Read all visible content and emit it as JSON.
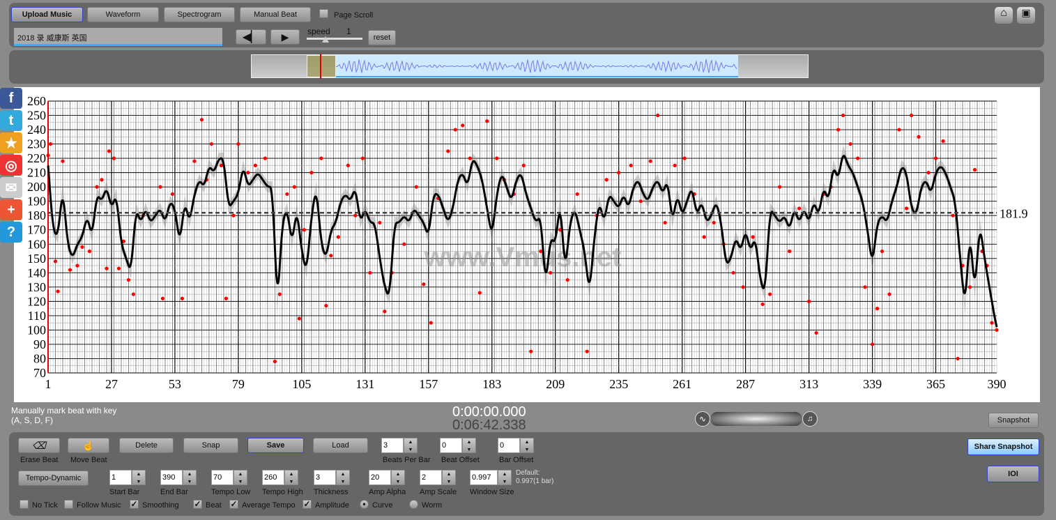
{
  "toolbar": {
    "upload": "Upload Music",
    "waveform": "Waveform",
    "spectrogram": "Spectrogram",
    "manual_beat": "Manual Beat",
    "page_scroll": "Page Scroll",
    "song_title": "2018 录 威康斯 英国",
    "speed_label": "speed",
    "speed_value": "1",
    "reset": "reset"
  },
  "social": [
    "facebook-icon",
    "twitter-icon",
    "favorite-icon",
    "weibo-icon",
    "email-icon",
    "add-icon",
    "help-icon"
  ],
  "status": {
    "hint_line1": "Manually mark beat with key",
    "hint_line2": "(A, S, D, F)",
    "time_current": "0:00:00.000",
    "time_total": "0:06:42.338",
    "snapshot": "Snapshot",
    "share_snapshot": "Share Snapshot",
    "ioi": "IOI"
  },
  "controls": {
    "erase_beat": "Erase Beat",
    "move_beat": "Move Beat",
    "delete": "Delete",
    "snap": "Snap",
    "save": "Save",
    "load": "Load",
    "tempo_dynamic": "Tempo-Dynamic",
    "beats_per_bar": {
      "label": "Beats Per Bar",
      "value": "3"
    },
    "beat_offset": {
      "label": "Beat Offset",
      "value": "0"
    },
    "bar_offset": {
      "label": "Bar Offset",
      "value": "0"
    },
    "start_bar": {
      "label": "Start Bar",
      "value": "1"
    },
    "end_bar": {
      "label": "End Bar",
      "value": "390"
    },
    "tempo_low": {
      "label": "Tempo Low",
      "value": "70"
    },
    "tempo_high": {
      "label": "Tempo High",
      "value": "260"
    },
    "thickness": {
      "label": "Thickness",
      "value": "3"
    },
    "amp_alpha": {
      "label": "Amp Alpha",
      "value": "20"
    },
    "amp_scale": {
      "label": "Amp Scale",
      "value": "2"
    },
    "window_size": {
      "label": "Window Size",
      "value": "0.997"
    },
    "default_line1": "Default:",
    "default_line2": "0.997(1 bar)",
    "no_tick": {
      "label": "No Tick",
      "checked": false
    },
    "follow_music": {
      "label": "Follow Music",
      "checked": false
    },
    "smoothing": {
      "label": "Smoothing",
      "checked": true
    },
    "beat": {
      "label": "Beat",
      "checked": true
    },
    "average_tempo": {
      "label": "Average Tempo",
      "checked": true
    },
    "amplitude": {
      "label": "Amplitude",
      "checked": true
    },
    "curve": {
      "label": "Curve",
      "selected": true
    },
    "worm": {
      "label": "Worm",
      "selected": false
    }
  },
  "chart_data": {
    "type": "line",
    "watermark": "www.Vmus.net",
    "xlim": [
      1,
      390
    ],
    "ylim": [
      70,
      260
    ],
    "x_ticks": [
      1,
      27,
      53,
      79,
      105,
      131,
      157,
      183,
      209,
      235,
      261,
      287,
      313,
      339,
      365,
      390
    ],
    "y_ticks": [
      70,
      80,
      90,
      100,
      110,
      120,
      130,
      140,
      150,
      160,
      170,
      180,
      190,
      200,
      210,
      220,
      230,
      240,
      250,
      260
    ],
    "average_tempo": 181.9,
    "average_label": "181.9",
    "colors": {
      "curve": "#000000",
      "beats": "#ff0000",
      "average": "#444444"
    },
    "curve": [
      [
        1,
        215
      ],
      [
        3,
        170
      ],
      [
        5,
        165
      ],
      [
        7,
        200
      ],
      [
        9,
        160
      ],
      [
        11,
        150
      ],
      [
        13,
        160
      ],
      [
        15,
        165
      ],
      [
        17,
        180
      ],
      [
        19,
        165
      ],
      [
        21,
        195
      ],
      [
        23,
        190
      ],
      [
        25,
        200
      ],
      [
        27,
        185
      ],
      [
        29,
        195
      ],
      [
        31,
        160
      ],
      [
        33,
        150
      ],
      [
        35,
        140
      ],
      [
        37,
        185
      ],
      [
        39,
        175
      ],
      [
        41,
        185
      ],
      [
        43,
        175
      ],
      [
        45,
        180
      ],
      [
        47,
        185
      ],
      [
        49,
        175
      ],
      [
        51,
        190
      ],
      [
        53,
        185
      ],
      [
        55,
        160
      ],
      [
        57,
        190
      ],
      [
        59,
        175
      ],
      [
        61,
        195
      ],
      [
        63,
        205
      ],
      [
        65,
        200
      ],
      [
        67,
        215
      ],
      [
        69,
        210
      ],
      [
        71,
        220
      ],
      [
        73,
        220
      ],
      [
        75,
        185
      ],
      [
        77,
        190
      ],
      [
        79,
        195
      ],
      [
        81,
        215
      ],
      [
        83,
        200
      ],
      [
        85,
        205
      ],
      [
        87,
        210
      ],
      [
        89,
        205
      ],
      [
        91,
        200
      ],
      [
        93,
        200
      ],
      [
        95,
        115
      ],
      [
        97,
        175
      ],
      [
        99,
        185
      ],
      [
        101,
        160
      ],
      [
        103,
        185
      ],
      [
        105,
        155
      ],
      [
        107,
        140
      ],
      [
        109,
        180
      ],
      [
        111,
        200
      ],
      [
        113,
        160
      ],
      [
        115,
        150
      ],
      [
        117,
        170
      ],
      [
        119,
        175
      ],
      [
        121,
        190
      ],
      [
        123,
        195
      ],
      [
        125,
        190
      ],
      [
        127,
        200
      ],
      [
        129,
        175
      ],
      [
        131,
        185
      ],
      [
        133,
        175
      ],
      [
        135,
        175
      ],
      [
        137,
        150
      ],
      [
        139,
        130
      ],
      [
        141,
        122
      ],
      [
        143,
        175
      ],
      [
        145,
        175
      ],
      [
        147,
        180
      ],
      [
        149,
        175
      ],
      [
        151,
        185
      ],
      [
        153,
        180
      ],
      [
        155,
        175
      ],
      [
        157,
        165
      ],
      [
        159,
        195
      ],
      [
        161,
        195
      ],
      [
        163,
        185
      ],
      [
        165,
        175
      ],
      [
        167,
        185
      ],
      [
        169,
        205
      ],
      [
        171,
        210
      ],
      [
        173,
        200
      ],
      [
        175,
        220
      ],
      [
        177,
        215
      ],
      [
        179,
        205
      ],
      [
        181,
        185
      ],
      [
        183,
        165
      ],
      [
        185,
        195
      ],
      [
        187,
        210
      ],
      [
        189,
        200
      ],
      [
        191,
        190
      ],
      [
        193,
        205
      ],
      [
        195,
        210
      ],
      [
        197,
        195
      ],
      [
        199,
        185
      ],
      [
        201,
        175
      ],
      [
        203,
        180
      ],
      [
        205,
        130
      ],
      [
        207,
        165
      ],
      [
        209,
        160
      ],
      [
        211,
        190
      ],
      [
        213,
        140
      ],
      [
        215,
        175
      ],
      [
        217,
        185
      ],
      [
        219,
        170
      ],
      [
        221,
        155
      ],
      [
        223,
        125
      ],
      [
        225,
        165
      ],
      [
        227,
        190
      ],
      [
        229,
        175
      ],
      [
        231,
        195
      ],
      [
        233,
        190
      ],
      [
        235,
        185
      ],
      [
        237,
        195
      ],
      [
        239,
        185
      ],
      [
        241,
        200
      ],
      [
        243,
        205
      ],
      [
        245,
        195
      ],
      [
        247,
        190
      ],
      [
        249,
        200
      ],
      [
        251,
        205
      ],
      [
        253,
        195
      ],
      [
        255,
        205
      ],
      [
        257,
        175
      ],
      [
        259,
        195
      ],
      [
        261,
        180
      ],
      [
        263,
        190
      ],
      [
        265,
        200
      ],
      [
        267,
        180
      ],
      [
        269,
        190
      ],
      [
        271,
        175
      ],
      [
        273,
        180
      ],
      [
        275,
        190
      ],
      [
        277,
        175
      ],
      [
        279,
        145
      ],
      [
        281,
        150
      ],
      [
        283,
        165
      ],
      [
        285,
        155
      ],
      [
        287,
        170
      ],
      [
        289,
        155
      ],
      [
        291,
        165
      ],
      [
        293,
        135
      ],
      [
        295,
        125
      ],
      [
        297,
        185
      ],
      [
        299,
        180
      ],
      [
        301,
        175
      ],
      [
        303,
        180
      ],
      [
        305,
        170
      ],
      [
        307,
        185
      ],
      [
        309,
        175
      ],
      [
        311,
        185
      ],
      [
        313,
        175
      ],
      [
        315,
        190
      ],
      [
        317,
        180
      ],
      [
        319,
        200
      ],
      [
        321,
        190
      ],
      [
        323,
        215
      ],
      [
        325,
        205
      ],
      [
        327,
        225
      ],
      [
        329,
        215
      ],
      [
        331,
        210
      ],
      [
        333,
        200
      ],
      [
        335,
        190
      ],
      [
        337,
        170
      ],
      [
        339,
        145
      ],
      [
        341,
        175
      ],
      [
        343,
        180
      ],
      [
        345,
        175
      ],
      [
        347,
        190
      ],
      [
        349,
        200
      ],
      [
        351,
        215
      ],
      [
        353,
        210
      ],
      [
        355,
        185
      ],
      [
        357,
        180
      ],
      [
        359,
        200
      ],
      [
        361,
        205
      ],
      [
        363,
        195
      ],
      [
        365,
        210
      ],
      [
        367,
        215
      ],
      [
        369,
        210
      ],
      [
        371,
        200
      ],
      [
        373,
        190
      ],
      [
        375,
        150
      ],
      [
        377,
        115
      ],
      [
        379,
        170
      ],
      [
        381,
        125
      ],
      [
        383,
        175
      ],
      [
        385,
        150
      ],
      [
        387,
        130
      ],
      [
        389,
        110
      ],
      [
        390,
        102
      ]
    ],
    "beats": [
      [
        1,
        222
      ],
      [
        2,
        230
      ],
      [
        4,
        148
      ],
      [
        5,
        127
      ],
      [
        7,
        218
      ],
      [
        10,
        142
      ],
      [
        13,
        145
      ],
      [
        15,
        158
      ],
      [
        18,
        155
      ],
      [
        21,
        200
      ],
      [
        23,
        205
      ],
      [
        25,
        143
      ],
      [
        26,
        225
      ],
      [
        28,
        220
      ],
      [
        30,
        143
      ],
      [
        32,
        162
      ],
      [
        34,
        135
      ],
      [
        36,
        125
      ],
      [
        40,
        180
      ],
      [
        47,
        200
      ],
      [
        48,
        122
      ],
      [
        52,
        195
      ],
      [
        56,
        122
      ],
      [
        61,
        218
      ],
      [
        64,
        247
      ],
      [
        66,
        205
      ],
      [
        68,
        230
      ],
      [
        72,
        215
      ],
      [
        74,
        122
      ],
      [
        77,
        180
      ],
      [
        79,
        230
      ],
      [
        83,
        210
      ],
      [
        86,
        215
      ],
      [
        90,
        220
      ],
      [
        94,
        78
      ],
      [
        96,
        125
      ],
      [
        99,
        195
      ],
      [
        102,
        200
      ],
      [
        104,
        108
      ],
      [
        106,
        170
      ],
      [
        109,
        210
      ],
      [
        113,
        220
      ],
      [
        115,
        117
      ],
      [
        117,
        152
      ],
      [
        120,
        165
      ],
      [
        124,
        215
      ],
      [
        127,
        180
      ],
      [
        130,
        220
      ],
      [
        133,
        140
      ],
      [
        137,
        175
      ],
      [
        139,
        113
      ],
      [
        142,
        140
      ],
      [
        147,
        160
      ],
      [
        152,
        200
      ],
      [
        155,
        132
      ],
      [
        158,
        105
      ],
      [
        161,
        192
      ],
      [
        165,
        225
      ],
      [
        168,
        240
      ],
      [
        171,
        243
      ],
      [
        174,
        220
      ],
      [
        178,
        126
      ],
      [
        181,
        246
      ],
      [
        185,
        220
      ],
      [
        188,
        205
      ],
      [
        192,
        195
      ],
      [
        196,
        215
      ],
      [
        199,
        85
      ],
      [
        203,
        155
      ],
      [
        207,
        140
      ],
      [
        211,
        170
      ],
      [
        214,
        135
      ],
      [
        218,
        195
      ],
      [
        222,
        85
      ],
      [
        226,
        180
      ],
      [
        230,
        205
      ],
      [
        235,
        210
      ],
      [
        240,
        215
      ],
      [
        244,
        190
      ],
      [
        248,
        218
      ],
      [
        251,
        250
      ],
      [
        254,
        175
      ],
      [
        258,
        215
      ],
      [
        262,
        220
      ],
      [
        266,
        195
      ],
      [
        270,
        165
      ],
      [
        274,
        175
      ],
      [
        278,
        160
      ],
      [
        282,
        140
      ],
      [
        286,
        130
      ],
      [
        290,
        165
      ],
      [
        294,
        118
      ],
      [
        297,
        125
      ],
      [
        301,
        200
      ],
      [
        305,
        155
      ],
      [
        309,
        185
      ],
      [
        313,
        120
      ],
      [
        316,
        98
      ],
      [
        319,
        195
      ],
      [
        322,
        200
      ],
      [
        325,
        240
      ],
      [
        327,
        250
      ],
      [
        330,
        230
      ],
      [
        333,
        220
      ],
      [
        336,
        130
      ],
      [
        339,
        90
      ],
      [
        341,
        115
      ],
      [
        343,
        155
      ],
      [
        346,
        125
      ],
      [
        350,
        240
      ],
      [
        353,
        185
      ],
      [
        355,
        250
      ],
      [
        358,
        235
      ],
      [
        362,
        210
      ],
      [
        365,
        220
      ],
      [
        368,
        232
      ],
      [
        372,
        180
      ],
      [
        374,
        80
      ],
      [
        376,
        145
      ],
      [
        379,
        130
      ],
      [
        381,
        212
      ],
      [
        384,
        155
      ],
      [
        386,
        145
      ],
      [
        388,
        105
      ],
      [
        390,
        100
      ]
    ]
  }
}
